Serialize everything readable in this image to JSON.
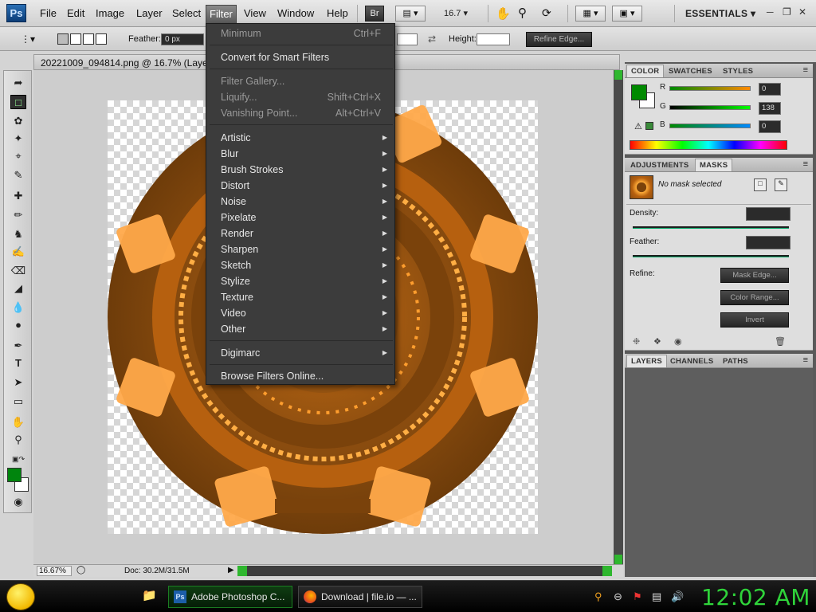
{
  "app": {
    "logo": "Ps"
  },
  "menubar": {
    "items": [
      "File",
      "Edit",
      "Image",
      "Layer",
      "Select",
      "Filter",
      "View",
      "Window",
      "Help"
    ],
    "bridge_label": "Br",
    "zoom_value": "16.7",
    "workspace": "ESSENTIALS"
  },
  "options": {
    "feather_label": "Feather:",
    "feather_value": "0 px",
    "height_label": "Height:",
    "refine_edge": "Refine Edge..."
  },
  "document": {
    "tab_title": "20221009_094814.png @ 16.7% (Layer 0"
  },
  "status": {
    "zoom": "16.67%",
    "doc_size": "Doc: 30.2M/31.5M"
  },
  "filter_menu": {
    "group1": [
      {
        "label": "Minimum",
        "shortcut": "Ctrl+F",
        "dim": true
      }
    ],
    "group2": [
      {
        "label": "Convert for Smart Filters"
      }
    ],
    "group3": [
      {
        "label": "Filter Gallery...",
        "dim": true
      },
      {
        "label": "Liquify...",
        "shortcut": "Shift+Ctrl+X",
        "dim": true
      },
      {
        "label": "Vanishing Point...",
        "shortcut": "Alt+Ctrl+V",
        "dim": true
      }
    ],
    "submenus": [
      "Artistic",
      "Blur",
      "Brush Strokes",
      "Distort",
      "Noise",
      "Pixelate",
      "Render",
      "Sharpen",
      "Sketch",
      "Stylize",
      "Texture",
      "Video",
      "Other"
    ],
    "digimarc": "Digimarc",
    "browse": "Browse Filters Online..."
  },
  "color_panel": {
    "tabs": [
      "COLOR",
      "SWATCHES",
      "STYLES"
    ],
    "r_label": "R",
    "r_value": "0",
    "g_label": "G",
    "g_value": "138",
    "b_label": "B",
    "b_value": "0",
    "foreground_color": "#008a00"
  },
  "masks_panel": {
    "tabs": [
      "ADJUSTMENTS",
      "MASKS"
    ],
    "no_mask": "No mask selected",
    "density_label": "Density:",
    "feather_label": "Feather:",
    "refine_label": "Refine:",
    "mask_edge": "Mask Edge...",
    "color_range": "Color Range...",
    "invert": "Invert"
  },
  "layers_panel": {
    "tabs": [
      "LAYERS",
      "CHANNELS",
      "PATHS"
    ]
  },
  "taskbar": {
    "task1": "Adobe Photoshop C...",
    "task2": "Download | file.io — ...",
    "clock": "12:02 AM"
  }
}
